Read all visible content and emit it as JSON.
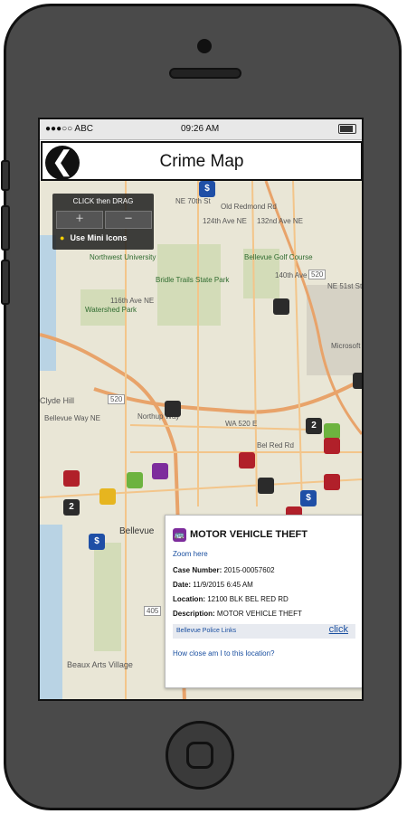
{
  "status": {
    "carrier": "●●●○○ ABC",
    "time": "09:26 AM"
  },
  "header": {
    "title": "Crime Map",
    "back_glyph": "❮"
  },
  "map": {
    "controls": {
      "drag_label": "CLICK then DRAG",
      "zoom_in": "＋",
      "zoom_out": "－",
      "mini_icons": "Use Mini Icons"
    },
    "labels": {
      "nw_university": "Northwest University",
      "watershed": "Watershed Park",
      "bridle": "Bridle Trails State Park",
      "bellevue_golf": "Bellevue Golf Course",
      "microsoft": "Microsoft",
      "clyde_hill": "Clyde Hill",
      "bellevue": "Bellevue",
      "beaux_arts": "Beaux Arts Village",
      "old_redmond": "Old Redmond Rd",
      "ne70": "NE 70th St",
      "wa520": "WA 520 E",
      "ave116": "116th Ave NE",
      "ave124": "124th Ave NE",
      "ave132": "132nd Ave NE",
      "ave140": "140th Ave NE",
      "bellevue_way": "Bellevue Way NE",
      "bel_red": "Bel Red Rd",
      "northup": "Northup Way",
      "i405": "405",
      "route520": "520",
      "ne51": "NE 51st St"
    },
    "pins": {
      "count_2a": "2",
      "count_2b": "2",
      "count_2c": "2",
      "dollar": "$"
    }
  },
  "popup": {
    "title": "MOTOR VEHICLE THEFT",
    "zoom_here": "Zoom here",
    "case_label": "Case Number:",
    "case_value": "2015-00057602",
    "date_label": "Date:",
    "date_value": "11/9/2015 6:45 AM",
    "location_label": "Location:",
    "location_value": "12100 BLK BEL RED RD",
    "description_label": "Description:",
    "description_value": "MOTOR VEHICLE THEFT",
    "links_label": "Bellevue Police Links",
    "links_click": "click",
    "how_close": "How close am I to this location?"
  },
  "colors": {
    "burglary": "#9c1c1c",
    "theft": "#b1202a",
    "vehicle": "#7d2c9c",
    "robbery": "#1f4fa6",
    "vandalism": "#2b2b2b",
    "drug": "#6db33f",
    "map_bg": "#e9e6d6"
  },
  "icons": {
    "back": "back-arrow-icon",
    "zoom_in": "zoom-in-icon",
    "zoom_out": "zoom-out-icon",
    "bulb": "lightbulb-icon",
    "vehicle": "car-icon"
  }
}
